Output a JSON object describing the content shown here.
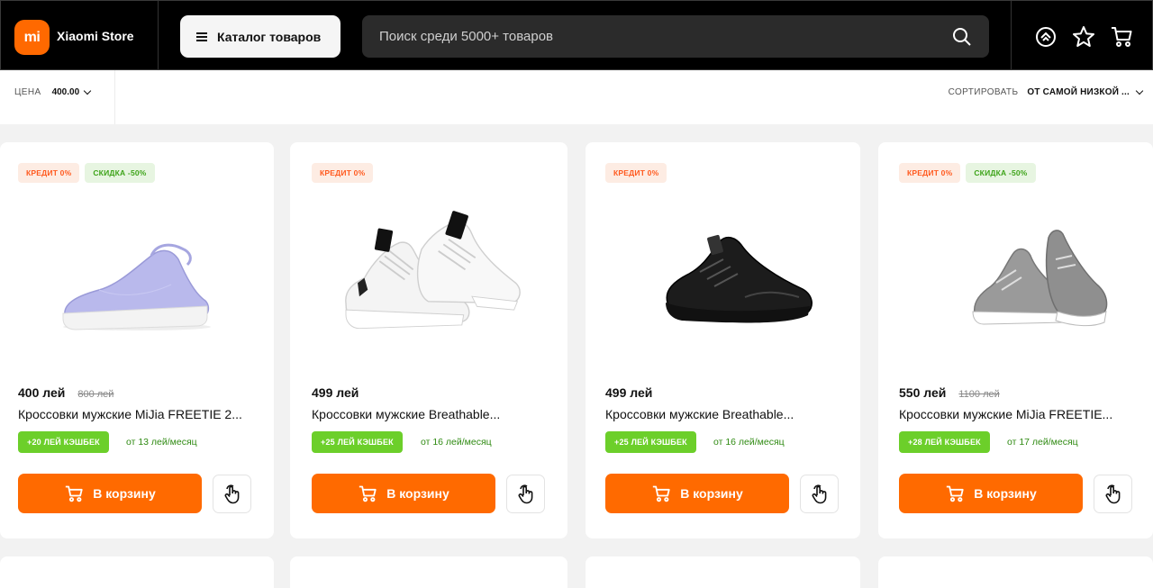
{
  "header": {
    "logo_text": "mi",
    "brand": "Xiaomi Store",
    "catalog_label": "Каталог товаров",
    "search_placeholder": "Поиск среди 5000+ товаров",
    "icons": [
      "compare-icon",
      "favorites-star-icon",
      "cart-icon"
    ],
    "accent": "#ff6900"
  },
  "filters": {
    "price_label": "ЦЕНА",
    "price_value": "400.00",
    "sort_label": "СОРТИРОВАТЬ",
    "sort_value": "ОТ САМОЙ НИЗКОЙ ..."
  },
  "products": [
    {
      "badge_credit": "КРЕДИТ 0%",
      "badge_sale": "СКИДКА -50%",
      "price": "400 лей",
      "old_price": "800 лей",
      "title": "Кроссовки мужские MiJia FREETIE 2...",
      "cashback": "+20 ЛЕЙ КЭШБЕК",
      "monthly": "от 13 лей/месяц",
      "cart_label": "В корзину",
      "image": "lavender-sneaker"
    },
    {
      "badge_credit": "КРЕДИТ 0%",
      "price": "499 лей",
      "title": "Кроссовки мужские Breathable...",
      "cashback": "+25 ЛЕЙ КЭШБЕК",
      "monthly": "от 16 лей/месяц",
      "cart_label": "В корзину",
      "image": "white-sneakers"
    },
    {
      "badge_credit": "КРЕДИТ 0%",
      "price": "499 лей",
      "title": "Кроссовки мужские Breathable...",
      "cashback": "+25 ЛЕЙ КЭШБЕК",
      "monthly": "от 16 лей/месяц",
      "cart_label": "В корзину",
      "image": "black-sneaker"
    },
    {
      "badge_credit": "КРЕДИТ 0%",
      "badge_sale": "СКИДКА -50%",
      "price": "550 лей",
      "old_price": "1100 лей",
      "title": "Кроссовки мужские MiJia FREETIE...",
      "cashback": "+28 ЛЕЙ КЭШБЕК",
      "monthly": "от 17 лей/месяц",
      "cart_label": "В корзину",
      "image": "gray-sneakers"
    }
  ],
  "colors": {
    "primary": "#ff6a00",
    "cashback": "#6ccf2a",
    "credit_badge_text": "#ff5a1f",
    "sale_badge_text": "#3ea41a"
  }
}
